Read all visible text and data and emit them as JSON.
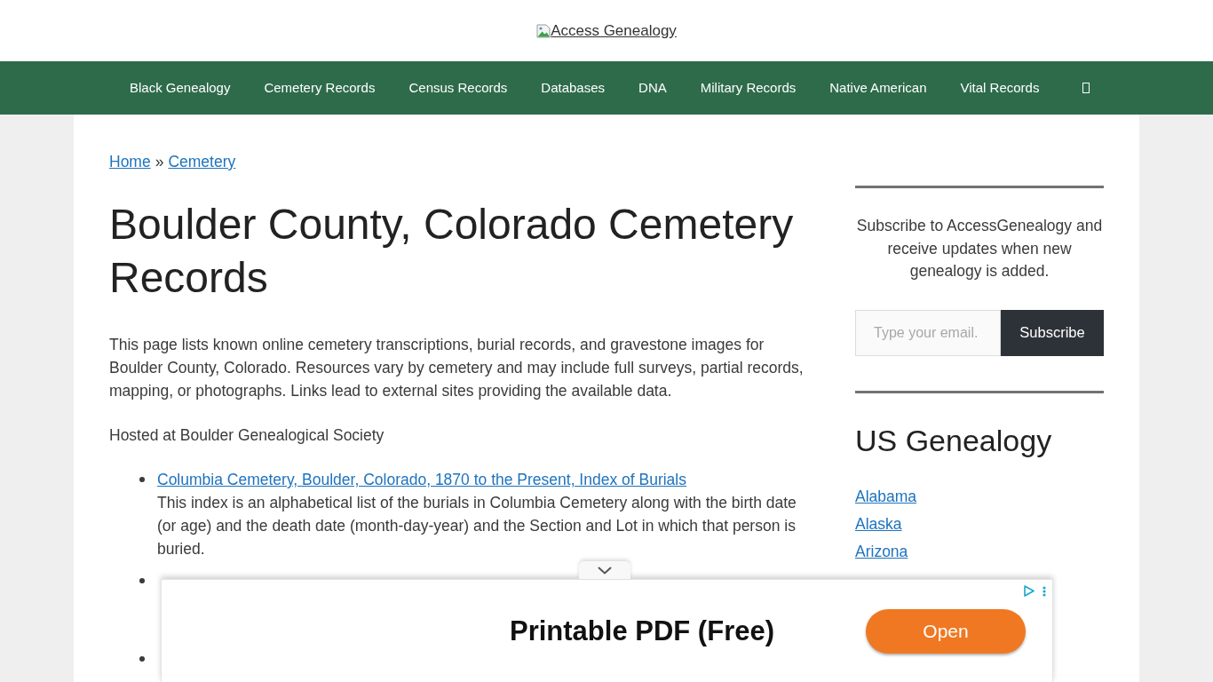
{
  "header": {
    "logo_alt": "Access Genealogy"
  },
  "nav": {
    "items": [
      {
        "kind": "link",
        "label": "Black Genealogy"
      },
      {
        "kind": "link",
        "label": "Cemetery Records"
      },
      {
        "kind": "link",
        "label": "Census Records"
      },
      {
        "kind": "link",
        "label": "Databases"
      },
      {
        "kind": "link",
        "label": "DNA"
      },
      {
        "kind": "link",
        "label": "Military Records"
      },
      {
        "kind": "link",
        "label": "Native American"
      },
      {
        "kind": "link",
        "label": "Vital Records"
      },
      {
        "kind": "icon"
      }
    ]
  },
  "breadcrumb": {
    "links": [
      "Home",
      "Cemetery"
    ],
    "separator": "»"
  },
  "article": {
    "title": "Boulder County, Colorado Cemetery Records",
    "intro": "This page lists known online cemetery transcriptions, burial records, and gravestone images for Boulder County, Colorado. Resources vary by cemetery and may include full surveys, partial records, mapping, or photographs. Links lead to external sites providing the available data.",
    "source": "Hosted at Boulder Genealogical Society",
    "entries": [
      {
        "kind": "entry",
        "link": "Columbia Cemetery, Boulder, Colorado, 1870 to the Present, Index of Burials",
        "description": "This index is an alphabetical list of the burials in Columbia Cemetery along with the birth date (or age) and the death date (month-day-year) and the Section and Lot in which that person is buried."
      },
      {
        "kind": "covered"
      },
      {
        "kind": "covered"
      }
    ]
  },
  "sidebar": {
    "subscribe": {
      "text": "Subscribe to AccessGenealogy and receive updates when new genealogy is added.",
      "placeholder": "Type your email.",
      "button": "Subscribe"
    },
    "us_genealogy": {
      "title": "US Genealogy",
      "links": [
        "Alabama",
        "Alaska",
        "Arizona"
      ]
    }
  },
  "ad": {
    "headline": "Printable PDF (Free)",
    "button": "Open"
  }
}
